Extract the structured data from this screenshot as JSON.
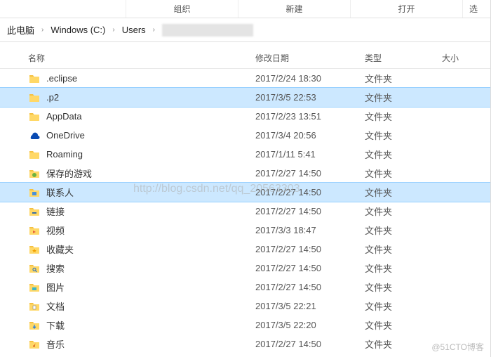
{
  "ribbon": {
    "organize": "组织",
    "new": "新建",
    "open": "打开",
    "select": "选"
  },
  "breadcrumb": {
    "items": [
      "此电脑",
      "Windows (C:)",
      "Users"
    ]
  },
  "headers": {
    "name": "名称",
    "date": "修改日期",
    "type": "类型",
    "size": "大小"
  },
  "items": [
    {
      "icon": "folder",
      "name": ".eclipse",
      "date": "2017/2/24 18:30",
      "type": "文件夹"
    },
    {
      "icon": "folder",
      "name": ".p2",
      "date": "2017/3/5 22:53",
      "type": "文件夹",
      "selected": true
    },
    {
      "icon": "folder",
      "name": "AppData",
      "date": "2017/2/23 13:51",
      "type": "文件夹"
    },
    {
      "icon": "onedrive",
      "name": "OneDrive",
      "date": "2017/3/4 20:56",
      "type": "文件夹"
    },
    {
      "icon": "folder",
      "name": "Roaming",
      "date": "2017/1/11 5:41",
      "type": "文件夹"
    },
    {
      "icon": "games",
      "name": "保存的游戏",
      "date": "2017/2/27 14:50",
      "type": "文件夹"
    },
    {
      "icon": "contacts",
      "name": "联系人",
      "date": "2017/2/27 14:50",
      "type": "文件夹",
      "selected": true
    },
    {
      "icon": "links",
      "name": "链接",
      "date": "2017/2/27 14:50",
      "type": "文件夹"
    },
    {
      "icon": "videos",
      "name": "视频",
      "date": "2017/3/3 18:47",
      "type": "文件夹"
    },
    {
      "icon": "favorites",
      "name": "收藏夹",
      "date": "2017/2/27 14:50",
      "type": "文件夹"
    },
    {
      "icon": "search",
      "name": "搜索",
      "date": "2017/2/27 14:50",
      "type": "文件夹"
    },
    {
      "icon": "pictures",
      "name": "图片",
      "date": "2017/2/27 14:50",
      "type": "文件夹"
    },
    {
      "icon": "documents",
      "name": "文档",
      "date": "2017/3/5 22:21",
      "type": "文件夹"
    },
    {
      "icon": "downloads",
      "name": "下载",
      "date": "2017/3/5 22:20",
      "type": "文件夹"
    },
    {
      "icon": "music",
      "name": "音乐",
      "date": "2017/2/27 14:50",
      "type": "文件夹"
    }
  ],
  "watermark": "http://blog.csdn.net/qq_20563303",
  "attribution": "@51CTO博客"
}
